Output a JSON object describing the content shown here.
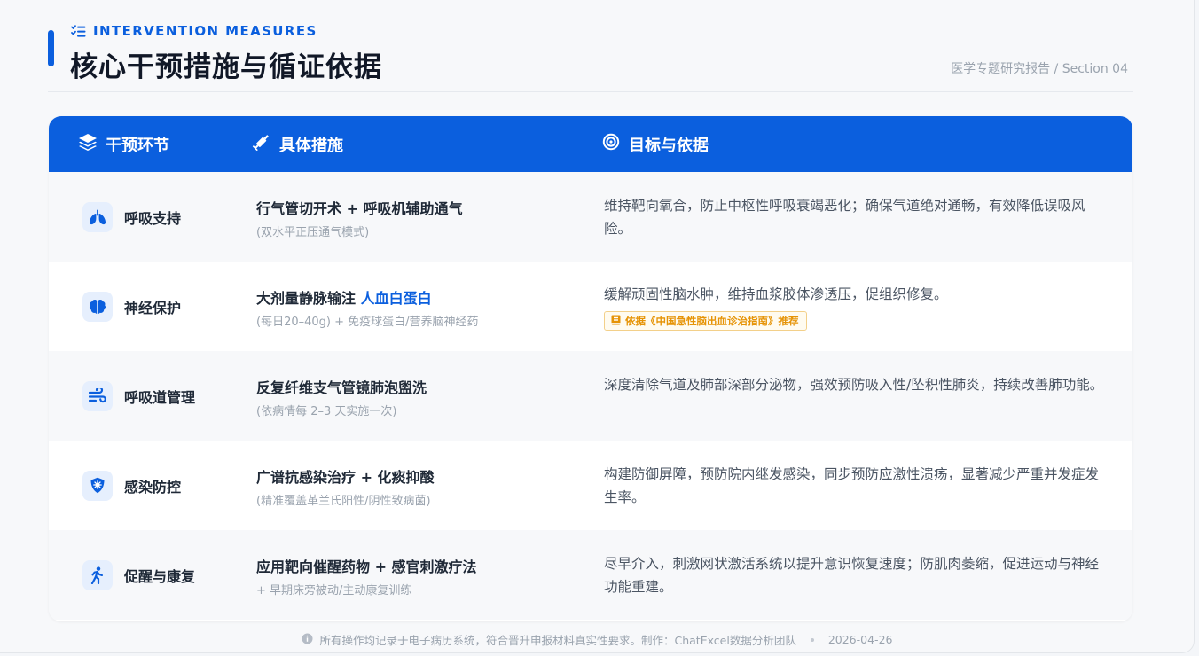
{
  "header": {
    "eyebrow": "INTERVENTION MEASURES",
    "title": "核心干预措施与循证依据",
    "breadcrumb": "医学专题研究报告 / Section 04"
  },
  "table": {
    "columns": [
      {
        "label": "干预环节",
        "icon": "layers-icon"
      },
      {
        "label": "具体措施",
        "icon": "syringe-icon"
      },
      {
        "label": "目标与依据",
        "icon": "target-icon"
      }
    ],
    "rows": [
      {
        "stage": "呼吸支持",
        "icon": "lungs-icon",
        "measure": "行气管切开术 + 呼吸机辅助通气",
        "measure_sub": "(双水平正压通气模式)",
        "goal": "维持靶向氧合，防止中枢性呼吸衰竭恶化；确保气道绝对通畅，有效降低误吸风险。"
      },
      {
        "stage": "神经保护",
        "icon": "brain-icon",
        "measure_prefix": "大剂量静脉输注 ",
        "measure_highlight": "人血白蛋白",
        "measure_sub": "(每日20–40g) + 免疫球蛋白/营养脑神经药",
        "goal": "缓解顽固性脑水肿，维持血浆胶体渗透压，促组织修复。",
        "badge": "依据《中国急性脑出血诊治指南》推荐",
        "badge_icon": "book-icon"
      },
      {
        "stage": "呼吸道管理",
        "icon": "wind-icon",
        "measure": "反复纤维支气管镜肺泡盥洗",
        "measure_sub": "(依病情每 2–3 天实施一次)",
        "goal": "深度清除气道及肺部深部分泌物，强效预防吸入性/坠积性肺炎，持续改善肺功能。"
      },
      {
        "stage": "感染防控",
        "icon": "virus-shield-icon",
        "measure": "广谱抗感染治疗 + 化痰抑酸",
        "measure_sub": "(精准覆盖革兰氏阳性/阴性致病菌)",
        "goal": "构建防御屏障，预防院内继发感染，同步预防应激性溃疡，显著减少严重并发症发生率。"
      },
      {
        "stage": "促醒与康复",
        "icon": "walking-icon",
        "measure": "应用靶向催醒药物 + 感官刺激疗法",
        "measure_sub": "+ 早期床旁被动/主动康复训练",
        "goal": "尽早介入，刺激网状激活系统以提升意识恢复速度；防肌肉萎缩，促进运动与神经功能重建。"
      }
    ]
  },
  "footer": {
    "icon": "info-icon",
    "note": "所有操作均记录于电子病历系统，符合晋升申报材料真实性要求。制作：ChatExcel数据分析团队",
    "date": "2026-04-26"
  },
  "colors": {
    "accent": "#0b5fde",
    "badge": "#e69306",
    "muted": "#9aa3ae"
  }
}
